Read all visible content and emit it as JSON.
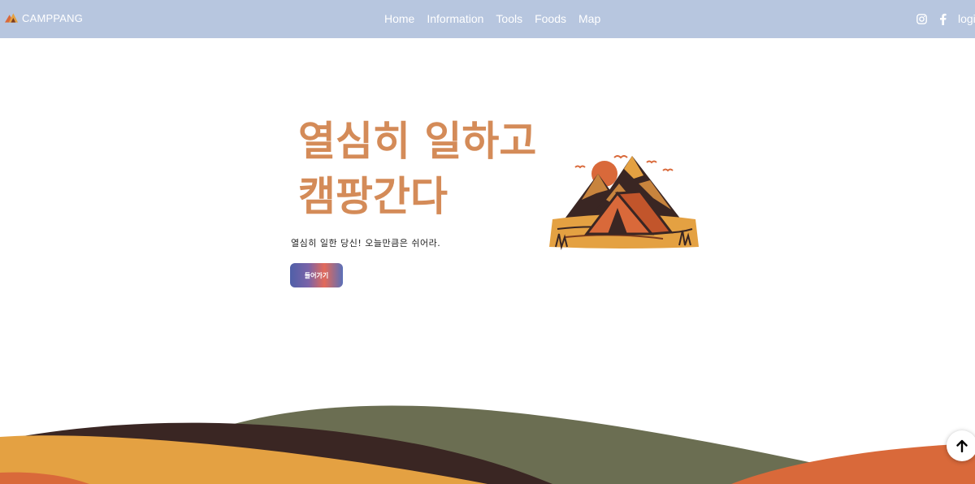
{
  "brand": {
    "name": "CAMPPANG",
    "logo_icon": "tent-logo-icon"
  },
  "nav": {
    "links": [
      "Home",
      "Information",
      "Tools",
      "Foods",
      "Map"
    ],
    "login": "login"
  },
  "social": {
    "icons": [
      "instagram-icon",
      "facebook-icon"
    ]
  },
  "hero": {
    "title_line1": "열심히 일하고",
    "title_line2": "캠팡간다",
    "subtitle": "열심히 일한 당신! 오늘만큼은 쉬어라.",
    "button": "들어가기"
  },
  "scroll_top_icon": "arrow-up-icon",
  "colors": {
    "navbar": "#b7c6df",
    "title": "#d48b58",
    "hill_gold": "#e4a142",
    "hill_dark_brown": "#3a2623",
    "hill_olive": "#6b6e52",
    "hill_orange": "#d9693a"
  }
}
